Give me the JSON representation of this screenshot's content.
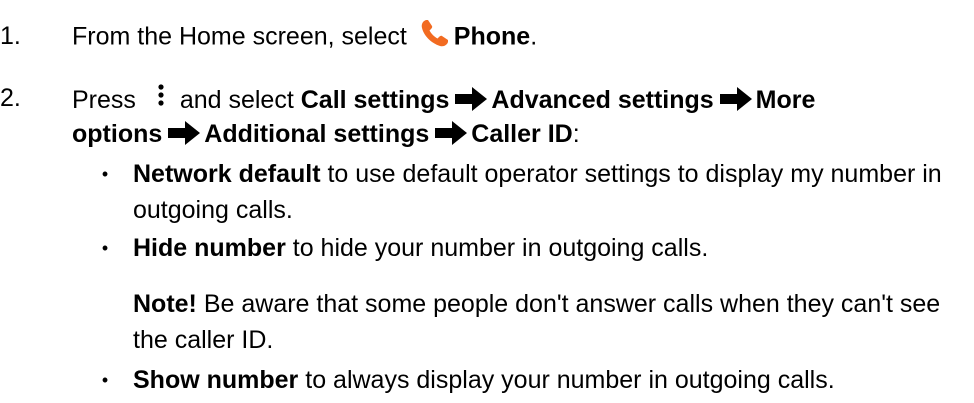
{
  "steps": [
    {
      "number": "1.",
      "pre": "From the Home screen, select",
      "icon": "phone-icon",
      "bold": "Phone",
      "post": "."
    },
    {
      "number": "2.",
      "pre": "Press",
      "icon": "more-vertical-icon",
      "mid": "and select",
      "path": [
        "Call settings",
        "Advanced settings",
        "More options",
        "Additional settings",
        "Caller ID"
      ],
      "post": ":"
    }
  ],
  "bullets": [
    {
      "bold": "Network default",
      "text": " to use default operator settings to display my number in outgoing calls."
    },
    {
      "bold": "Hide number",
      "text": " to hide your number in outgoing calls."
    },
    {
      "bold": "Show number",
      "text": " to always display your number in outgoing calls."
    }
  ],
  "note": {
    "bold": "Note!",
    "text": " Be aware that some people  don't  answer calls when they can't see the caller ID."
  },
  "colors": {
    "phone_icon": "#F26B21",
    "text": "#000000"
  }
}
